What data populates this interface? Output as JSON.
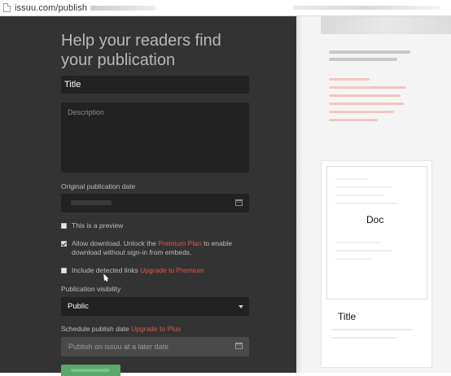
{
  "browser": {
    "url": "issuu.com/publish"
  },
  "form": {
    "heading": "Help your readers find your publication",
    "title_value": "Title",
    "description_placeholder": "Description",
    "original_date_label": "Original publication date",
    "preview_label": "This is a preview",
    "preview_checked": false,
    "download_label_prefix": "Allow download. Unlock the ",
    "download_link": "Premium Plan",
    "download_label_suffix": " to enable download without sign-in from embeds.",
    "download_checked": true,
    "links_label": "Include detected links",
    "links_upgrade": "Upgrade to Premium",
    "links_checked": false,
    "visibility_label": "Publication visibility",
    "visibility_value": "Public",
    "schedule_label": "Schedule publish date",
    "schedule_upgrade": "Upgrade to Plus",
    "schedule_placeholder": "Publish on issuu at a later date"
  },
  "preview": {
    "doc_label": "Doc",
    "title_label": "Title"
  },
  "colors": {
    "panel": "#333333",
    "field": "#222222",
    "accent_red": "#e0574a",
    "button_green": "#5aa86a"
  }
}
